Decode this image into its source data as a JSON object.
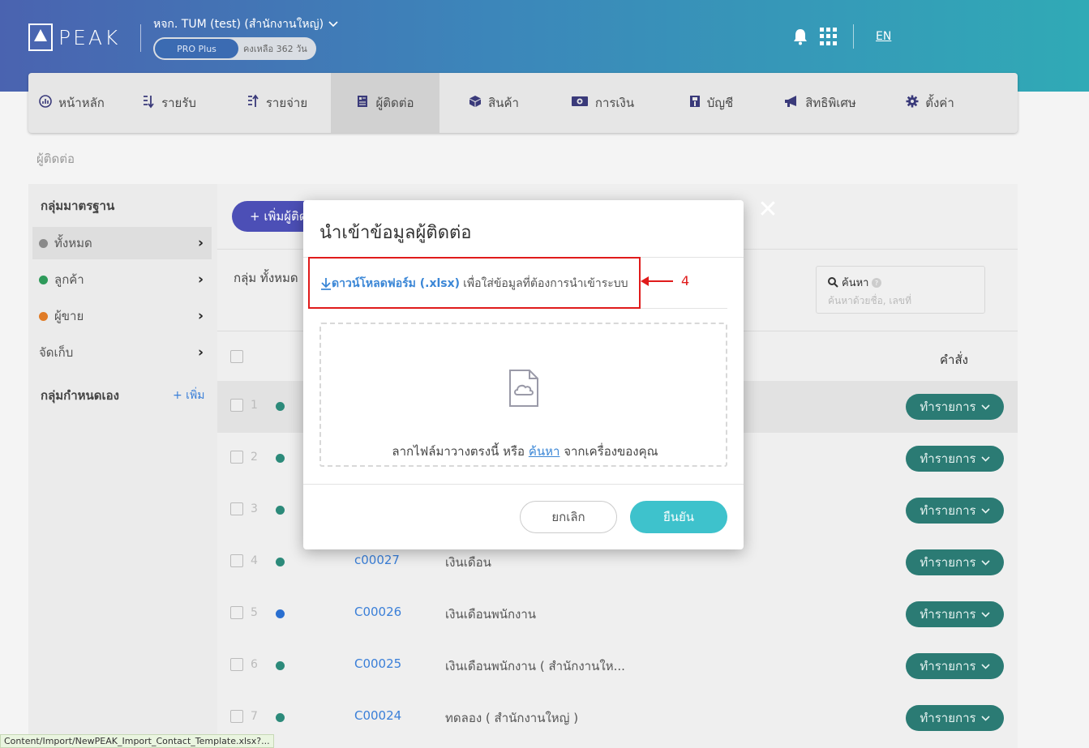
{
  "header": {
    "logo_text": "PEAK",
    "company": "หจก. TUM (test) (สำนักงานใหญ่)",
    "plan": "PRO Plus",
    "days_left": "คงเหลือ 362 วัน",
    "lang": "EN"
  },
  "nav": [
    {
      "label": "หน้าหลัก",
      "icon": "dashboard-icon"
    },
    {
      "label": "รายรับ",
      "icon": "income-icon"
    },
    {
      "label": "รายจ่าย",
      "icon": "expense-icon"
    },
    {
      "label": "ผู้ติดต่อ",
      "icon": "contacts-icon",
      "active": true
    },
    {
      "label": "สินค้า",
      "icon": "box-icon"
    },
    {
      "label": "การเงิน",
      "icon": "money-icon"
    },
    {
      "label": "บัญชี",
      "icon": "ledger-icon"
    },
    {
      "label": "สิทธิพิเศษ",
      "icon": "megaphone-icon"
    },
    {
      "label": "ตั้งค่า",
      "icon": "gear-icon"
    }
  ],
  "breadcrumb": "ผู้ติดต่อ",
  "sidebar": {
    "standard_heading": "กลุ่มมาตรฐาน",
    "items": [
      {
        "label": "ทั้งหมด",
        "color": "#8a8a8a"
      },
      {
        "label": "ลูกค้า",
        "color": "#2e9a5a"
      },
      {
        "label": "ผู้ขาย",
        "color": "#e07b26"
      },
      {
        "label": "จัดเก็บ",
        "color": ""
      }
    ],
    "custom_heading": "กลุ่มกำหนดเอง",
    "add_label": "+ เพิ่ม"
  },
  "main": {
    "add_button": "+ เพิ่มผู้ติด",
    "group_label": "กลุ่ม ทั้งหมด",
    "search_label": "ค้นหา",
    "search_placeholder": "ค้นหาด้วยชื่อ, เลขที่",
    "command_header": "คำสั่ง",
    "action_label": "ทำรายการ",
    "rows": [
      {
        "num": "1",
        "code": "",
        "name": "",
        "dot": "#2c8a7a"
      },
      {
        "num": "2",
        "code": "",
        "name": "",
        "dot": "#2c8a7a"
      },
      {
        "num": "3",
        "code": "",
        "name": "",
        "dot": "#2c8a7a"
      },
      {
        "num": "4",
        "code": "c00027",
        "name": "เงินเดือน",
        "dot": "#2c8a7a"
      },
      {
        "num": "5",
        "code": "C00026",
        "name": "เงินเดือนพนักงาน",
        "dot": "#2a6fd0"
      },
      {
        "num": "6",
        "code": "C00025",
        "name": "เงินเดือนพนักงาน ( สำนักงานให...",
        "dot": "#2c8a7a"
      },
      {
        "num": "7",
        "code": "C00024",
        "name": "ทดลอง ( สำนักงานใหญ่ )",
        "dot": "#2c8a7a"
      }
    ]
  },
  "modal": {
    "title": "นำเข้าข้อมูลผู้ติดต่อ",
    "download_link": "ดาวน์โหลดฟอร์ม (.xlsx)",
    "download_desc": "เพื่อใส่ข้อมูลที่ต้องการนำเข้าระบบ",
    "drop_text_before": "ลากไฟล์มาวางตรงนี้ หรือ",
    "drop_link": "ค้นหา",
    "drop_text_after": "จากเครื่องของคุณ",
    "cancel": "ยกเลิก",
    "confirm": "ยืนยัน"
  },
  "annotation": "4",
  "status_bar": "Content/Import/NewPEAK_Import_Contact_Template.xlsx?..."
}
